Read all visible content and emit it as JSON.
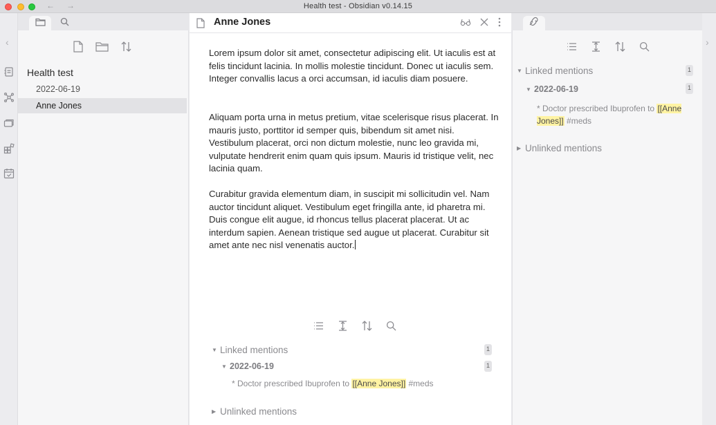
{
  "window": {
    "title": "Health test - Obsidian v0.14.15",
    "back_arrow": "←",
    "forward_arrow": "→"
  },
  "ribbon": {
    "collapse_glyph": "‹",
    "icons": [
      "open-quick-switcher-icon",
      "graph-view-icon",
      "slides-icon",
      "templates-icon",
      "daily-note-icon"
    ]
  },
  "left_sidebar": {
    "tabs": [
      "file-explorer-icon",
      "search-icon"
    ],
    "toolbar": [
      "new-note-icon",
      "new-folder-icon",
      "sort-icon"
    ],
    "vault_name": "Health test",
    "files": [
      {
        "name": "2022-06-19",
        "active": false
      },
      {
        "name": "Anne Jones",
        "active": true
      }
    ]
  },
  "editor": {
    "note_title": "Anne Jones",
    "actions": [
      "reading-view-icon",
      "close-icon",
      "more-options-icon"
    ],
    "paragraphs": [
      "Lorem ipsum dolor sit amet, consectetur adipiscing elit. Ut iaculis est at felis tincidunt lacinia. In mollis molestie tincidunt. Donec ut iaculis sem. Integer convallis lacus a orci accumsan, id iaculis diam posuere.",
      "Aliquam porta urna in metus pretium, vitae scelerisque risus placerat. In mauris justo, porttitor id semper quis, bibendum sit amet nisi. Vestibulum placerat, orci non dictum molestie, nunc leo gravida mi, vulputate hendrerit enim quam quis ipsum. Mauris id tristique velit, nec lacinia quam.",
      "Curabitur gravida elementum diam, in suscipit mi sollicitudin vel. Nam auctor tincidunt aliquet. Vestibulum eget fringilla ante, id pharetra mi. Duis congue elit augue, id rhoncus tellus placerat placerat. Ut ac interdum sapien. Aenean tristique sed augue ut placerat. Curabitur sit amet ante nec nisl venenatis auctor."
    ]
  },
  "backlinks": {
    "linked_label": "Linked mentions",
    "linked_count": "1",
    "group_date": "2022-06-19",
    "group_count": "1",
    "snippet_prefix": "* Doctor prescribed Ibuprofen to ",
    "snippet_link": "[[Anne Jones]]",
    "snippet_suffix": " #meds",
    "unlinked_label": "Unlinked mentions",
    "caret_open": "▼",
    "caret_closed": "▶"
  },
  "right_sidebar": {
    "tab_icon": "backlinks-pane-icon",
    "collapse_glyph": "›"
  },
  "colors": {
    "highlight": "#fff3a3",
    "active_file_bg": "#e2e2e5"
  }
}
